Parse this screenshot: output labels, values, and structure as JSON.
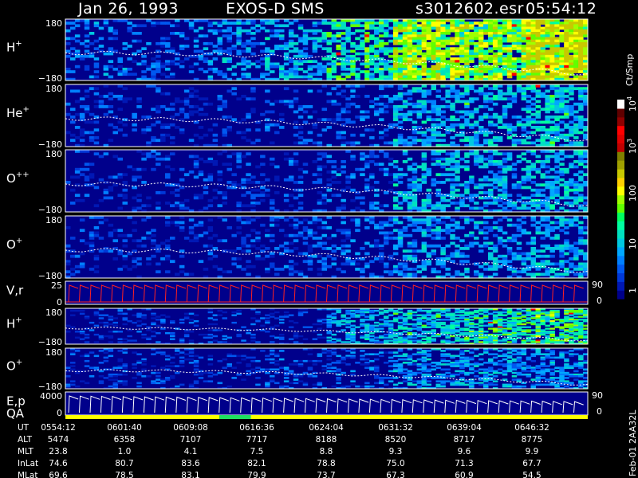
{
  "header": {
    "date": "Jan 26, 1993",
    "instrument": "EXOS-D SMS",
    "filename": "s3012602.esr",
    "time": "05:54:12"
  },
  "colorbar": {
    "unit_label": "Ct/Smp",
    "tick_labels": [
      "1",
      "10",
      "100",
      "10",
      "10"
    ],
    "tick_exponents": [
      "",
      "",
      "",
      "3",
      "4"
    ],
    "colors_bottom_to_top": [
      "#00008b",
      "#0018b4",
      "#0038d8",
      "#0058f0",
      "#0080ff",
      "#00a8ff",
      "#00c8e0",
      "#00e0c0",
      "#00ffa0",
      "#00ff60",
      "#60ff00",
      "#a0ff00",
      "#ffff00",
      "#ffd000",
      "#c8c800",
      "#a0a000",
      "#808000",
      "#c00000",
      "#e00000",
      "#ff0000",
      "#900000",
      "#600000",
      "#ffffff"
    ]
  },
  "side_label": "Feb-01 2AA32L",
  "chart_data": {
    "type": "heatmap",
    "x_time_labels": [
      "0554:12",
      "0601:40",
      "0609:08",
      "0616:36",
      "0624:04",
      "0631:32",
      "0639:04",
      "0646:32"
    ],
    "panels": [
      {
        "label": "H",
        "sup": "+",
        "ytop": "180",
        "ybot": "−180",
        "kind": "spectrogram",
        "intensity": [
          0.2,
          0.15,
          0.25,
          0.35,
          0.55,
          0.8,
          0.75,
          0.95
        ],
        "color": "#ffffff"
      },
      {
        "label": "He",
        "sup": "+",
        "ytop": "180",
        "ybot": "−180",
        "kind": "spectrogram",
        "intensity": [
          0.05,
          0.05,
          0.05,
          0.1,
          0.15,
          0.35,
          0.4,
          0.45
        ],
        "color": "#ffffff"
      },
      {
        "label": "O",
        "sup": "++",
        "ytop": "180",
        "ybot": "−180",
        "kind": "spectrogram",
        "intensity": [
          0.05,
          0.05,
          0.05,
          0.1,
          0.15,
          0.35,
          0.35,
          0.4
        ],
        "color": "#ffffff"
      },
      {
        "label": "O",
        "sup": "+",
        "ytop": "180",
        "ybot": "−180",
        "kind": "spectrogram",
        "intensity": [
          0.05,
          0.05,
          0.05,
          0.1,
          0.15,
          0.3,
          0.3,
          0.35
        ],
        "color": "#ffffff"
      },
      {
        "label": "V,r",
        "sup": "",
        "ytop": "25",
        "ybot": "0",
        "kind": "sawtooth",
        "right_top": "90",
        "right_bot": "0",
        "color": "#ff2020"
      },
      {
        "label": "H",
        "sup": "+",
        "ytop": "180",
        "ybot": "−180",
        "kind": "spectrogram",
        "intensity": [
          0.05,
          0.05,
          0.05,
          0.05,
          0.35,
          0.45,
          0.55,
          0.6
        ],
        "color": "#ffffff"
      },
      {
        "label": "O",
        "sup": "+",
        "ytop": "180",
        "ybot": "−180",
        "kind": "spectrogram",
        "intensity": [
          0.05,
          0.05,
          0.05,
          0.1,
          0.15,
          0.3,
          0.3,
          0.3
        ],
        "color": "#ffffff"
      },
      {
        "label": "E,p",
        "sup": "",
        "ytop": "4000",
        "ybot": "0",
        "kind": "sawtooth",
        "right_top": "90",
        "right_bot": "0",
        "color": "#ffffff"
      }
    ],
    "qa_label": "QA",
    "qa_segments": [
      {
        "from": 0.0,
        "to": 0.295,
        "color": "#ffff00"
      },
      {
        "from": 0.295,
        "to": 0.355,
        "color": "#20e060"
      },
      {
        "from": 0.355,
        "to": 1.0,
        "color": "#ffff00"
      }
    ]
  },
  "footer": {
    "rows": [
      {
        "label": "UT",
        "values": [
          "0554:12",
          "0601:40",
          "0609:08",
          "0616:36",
          "0624:04",
          "0631:32",
          "0639:04",
          "0646:32"
        ]
      },
      {
        "label": "ALT",
        "values": [
          "5474",
          "6358",
          "7107",
          "7717",
          "8188",
          "8520",
          "8717",
          "8775"
        ]
      },
      {
        "label": "MLT",
        "values": [
          "23.8",
          "1.0",
          "4.1",
          "7.5",
          "8.8",
          "9.3",
          "9.6",
          "9.9"
        ]
      },
      {
        "label": "InLat",
        "values": [
          "74.6",
          "80.7",
          "83.6",
          "82.1",
          "78.8",
          "75.0",
          "71.3",
          "67.7"
        ]
      },
      {
        "label": "MLat",
        "values": [
          "69.6",
          "78.5",
          "83.1",
          "79.9",
          "73.7",
          "67.3",
          "60.9",
          "54.5"
        ]
      }
    ]
  }
}
